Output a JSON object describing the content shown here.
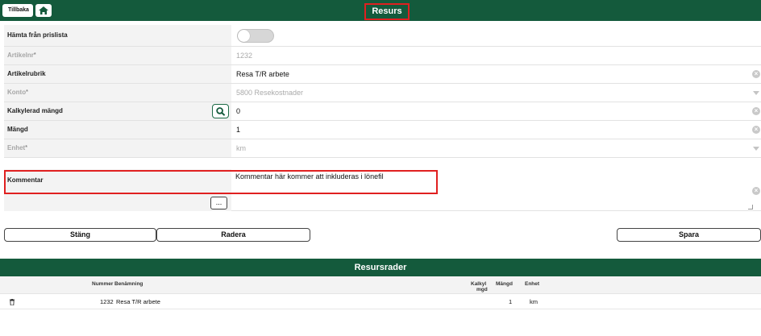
{
  "header": {
    "back_label": "Tillbaka",
    "title": "Resurs"
  },
  "form": {
    "fetch_from_pricelist_label": "Hämta från prislista",
    "article_no": {
      "label": "Artikelnr",
      "required": "*",
      "value": "1232"
    },
    "article_heading": {
      "label": "Artikelrubrik",
      "value": "Resa T/R arbete"
    },
    "account": {
      "label": "Konto",
      "required": "*",
      "value": "5800 Resekostnader"
    },
    "calc_quantity": {
      "label": "Kalkylerad mängd",
      "value": "0"
    },
    "quantity": {
      "label": "Mängd",
      "value": "1"
    },
    "unit": {
      "label": "Enhet",
      "required": "*",
      "value": "km"
    },
    "comment": {
      "label": "Kommentar",
      "value": "Kommentar här kommer att inkluderas i lönefil"
    },
    "more_label": "...",
    "clear_symbol": "×"
  },
  "actions": {
    "close_label": "Stäng",
    "delete_label": "Radera",
    "save_label": "Spara"
  },
  "resources": {
    "title": "Resursrader",
    "columns": {
      "number": "Nummer",
      "name": "Benämning",
      "calc_line1": "Kalkyl",
      "calc_line2": "mgd",
      "quantity": "Mängd",
      "unit": "Enhet"
    },
    "rows": [
      {
        "number": "1232",
        "name": "Resa T/R arbete",
        "quantity": "1",
        "unit": "km"
      }
    ]
  },
  "colors": {
    "header_green": "#145a3c",
    "highlight_red": "#e02020"
  },
  "icons": [
    "back-arrow-icon",
    "home-icon",
    "search-icon",
    "trash-icon",
    "clear-icon",
    "dropdown-caret-icon"
  ]
}
